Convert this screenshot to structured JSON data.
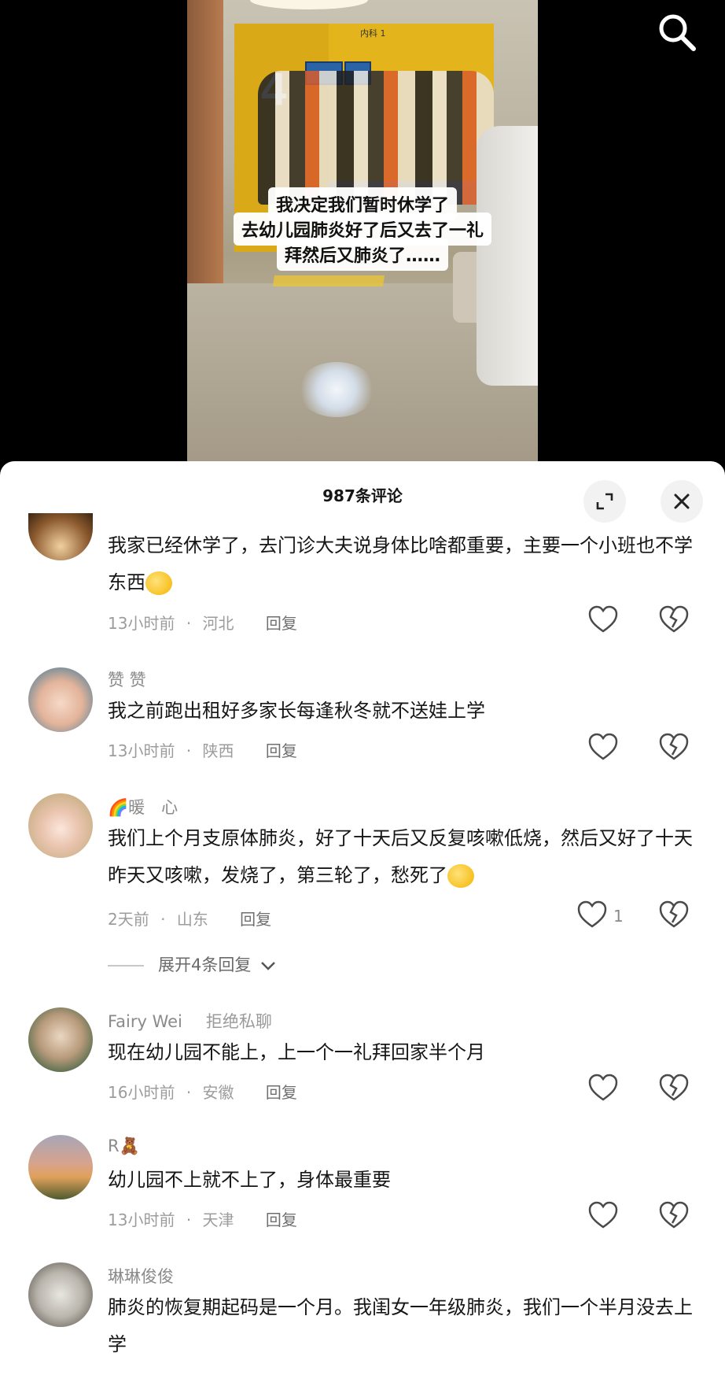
{
  "video": {
    "caption_lines": [
      "我决定我们暂时休学了",
      "去幼儿园肺炎好了后又去了一礼",
      "拜然后又肺炎了……"
    ],
    "sign_text": "内科 1",
    "floor_sign_text": "<<<   >>>",
    "room_number": "4"
  },
  "sheet": {
    "title": "987条评论"
  },
  "comments": [
    {
      "name": "",
      "text": "我家已经休学了，去门诊大夫说身体比啥都重要，主要一个小班也不学东西",
      "time": "13小时前",
      "location": "河北",
      "reply": "回复",
      "likes": ""
    },
    {
      "name": "赞 赞",
      "text": "我之前跑出租好多家长每逢秋冬就不送娃上学",
      "time": "13小时前",
      "location": "陕西",
      "reply": "回复",
      "likes": ""
    },
    {
      "name": "🌈暖　心",
      "text": "我们上个月支原体肺炎，好了十天后又反复咳嗽低烧，然后又好了十天昨天又咳嗽，发烧了，第三轮了，愁死了",
      "time": "2天前",
      "location": "山东",
      "reply": "回复",
      "likes": "1",
      "expand_replies": "展开4条回复"
    },
    {
      "name": "Fairy Wei",
      "badge": "拒绝私聊",
      "text": "现在幼儿园不能上，上一个一礼拜回家半个月",
      "time": "16小时前",
      "location": "安徽",
      "reply": "回复",
      "likes": ""
    },
    {
      "name": "R🧸",
      "text": "幼儿园不上就不上了，身体最重要",
      "time": "13小时前",
      "location": "天津",
      "reply": "回复",
      "likes": ""
    },
    {
      "name": "琳琳俊俊",
      "text": "肺炎的恢复期起码是一个月。我闺女一年级肺炎，我们一个半月没去上学",
      "time": "",
      "location": "",
      "reply": "",
      "likes": ""
    }
  ],
  "meta_separator": "·",
  "icons": {
    "search": "search-icon",
    "expand": "expand-icon",
    "close": "close-icon",
    "like": "heart-icon",
    "dislike": "broken-heart-icon",
    "chevron": "chevron-down-icon"
  },
  "colors": {
    "video_bg": "#000000",
    "sheet_bg": "#ffffff",
    "meta_text": "#9c9c9c",
    "name_text": "#8a8a8a"
  }
}
